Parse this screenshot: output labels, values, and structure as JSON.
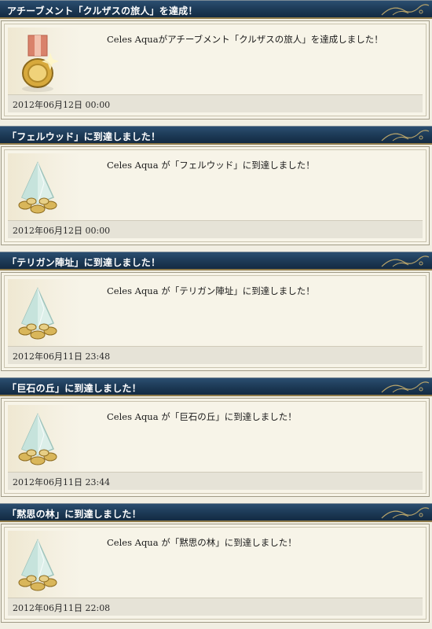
{
  "entries": [
    {
      "title": "アチーブメント「クルザスの旅人」を達成！",
      "icon": "medal-icon",
      "message": "Celes Aquaがアチーブメント「クルザスの旅人」を達成しました！",
      "timestamp": "2012年06月12日  00:00"
    },
    {
      "title": "「フェルウッド」に到達しました！",
      "icon": "crystal-icon",
      "message": "Celes Aqua が「フェルウッド」に到達しました！",
      "timestamp": "2012年06月12日  00:00"
    },
    {
      "title": "「テリガン陣址」に到達しました！",
      "icon": "crystal-icon",
      "message": "Celes Aqua が「テリガン陣址」に到達しました！",
      "timestamp": "2012年06月11日  23:48"
    },
    {
      "title": "「巨石の丘」に到達しました！",
      "icon": "crystal-icon",
      "message": "Celes Aqua が「巨石の丘」に到達しました！",
      "timestamp": "2012年06月11日  23:44"
    },
    {
      "title": "「黙思の林」に到達しました！",
      "icon": "crystal-icon",
      "message": "Celes Aqua が「黙思の林」に到達しました！",
      "timestamp": "2012年06月11日  22:08"
    }
  ],
  "colors": {
    "title_bar": "#1c3955",
    "title_border": "#8e7b4a",
    "card_bg": "#f6f3e7",
    "timestamp_bg": "#e6e3d7"
  }
}
